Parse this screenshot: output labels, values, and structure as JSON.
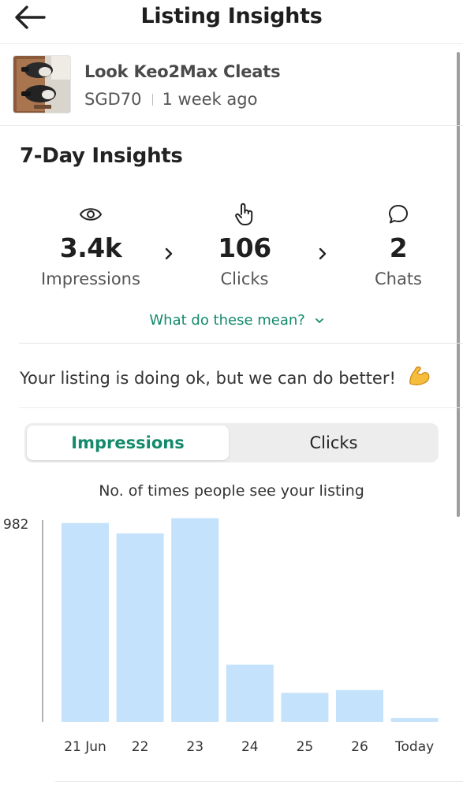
{
  "header": {
    "title": "Listing Insights",
    "back_icon": "arrow-left-icon"
  },
  "listing": {
    "title": "Look Keo2Max Cleats",
    "price": "SGD70",
    "posted": "1 week ago"
  },
  "insights": {
    "title": "7-Day Insights",
    "stats": [
      {
        "icon": "eye-icon",
        "value": "3.4k",
        "label": "Impressions"
      },
      {
        "icon": "hand-pointer-icon",
        "value": "106",
        "label": "Clicks"
      },
      {
        "icon": "chat-bubble-icon",
        "value": "2",
        "label": "Chats"
      }
    ],
    "help_link": "What do these mean?"
  },
  "message": {
    "text": "Your listing is doing ok, but we can do better!",
    "emoji": "flexed-biceps-icon"
  },
  "tabs": {
    "active": "Impressions",
    "inactive": "Clicks"
  },
  "chart_subtitle": "No. of times people see your listing",
  "colors": {
    "accent": "#138a6b",
    "bar": "#c4e2fb"
  },
  "chart_data": {
    "type": "bar",
    "categories": [
      "21 Jun",
      "22",
      "23",
      "24",
      "25",
      "26",
      "Today"
    ],
    "values": [
      982,
      931,
      1006,
      282,
      143,
      157,
      19
    ],
    "ytick_labels": [
      "982"
    ],
    "ylim": [
      0,
      1020
    ]
  }
}
